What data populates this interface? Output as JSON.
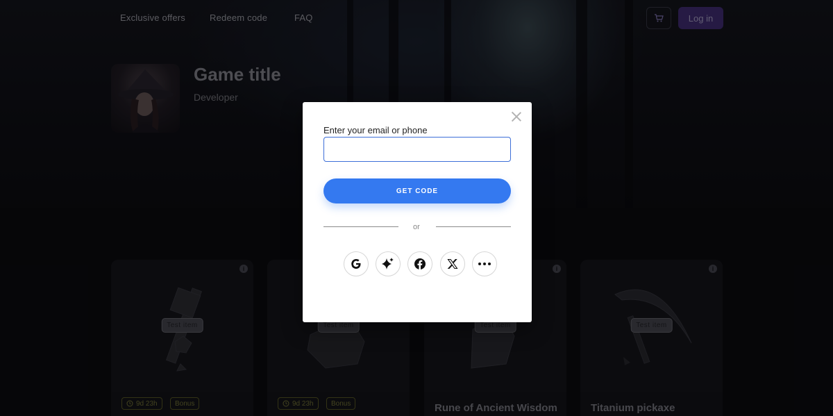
{
  "nav": {
    "links": [
      "Exclusive offers",
      "Redeem code",
      "FAQ"
    ],
    "login_label": "Log in",
    "cart_icon": "cart-icon"
  },
  "game": {
    "title": "Game title",
    "developer": "Developer"
  },
  "cards": [
    {
      "tag": "Test item",
      "timer": "9d 23h",
      "bonus": "Bonus",
      "name": ""
    },
    {
      "tag": "Test item",
      "timer": "9d 23h",
      "bonus": "Bonus",
      "name": ""
    },
    {
      "tag": "Test item",
      "timer": "",
      "bonus": "",
      "name": "Rune of Ancient Wisdom"
    },
    {
      "tag": "Test item",
      "timer": "",
      "bonus": "",
      "name": "Titanium pickaxe"
    }
  ],
  "modal": {
    "label": "Enter your email or phone",
    "input_value": "",
    "button_label": "GET CODE",
    "or_text": "or",
    "social_icons": [
      "google-icon",
      "sparkle-icon",
      "facebook-icon",
      "x-icon",
      "more-icon"
    ]
  },
  "colors": {
    "primary_button": "#3479f0",
    "login_button": "#45307c",
    "badge_border": "#5d5d27"
  }
}
